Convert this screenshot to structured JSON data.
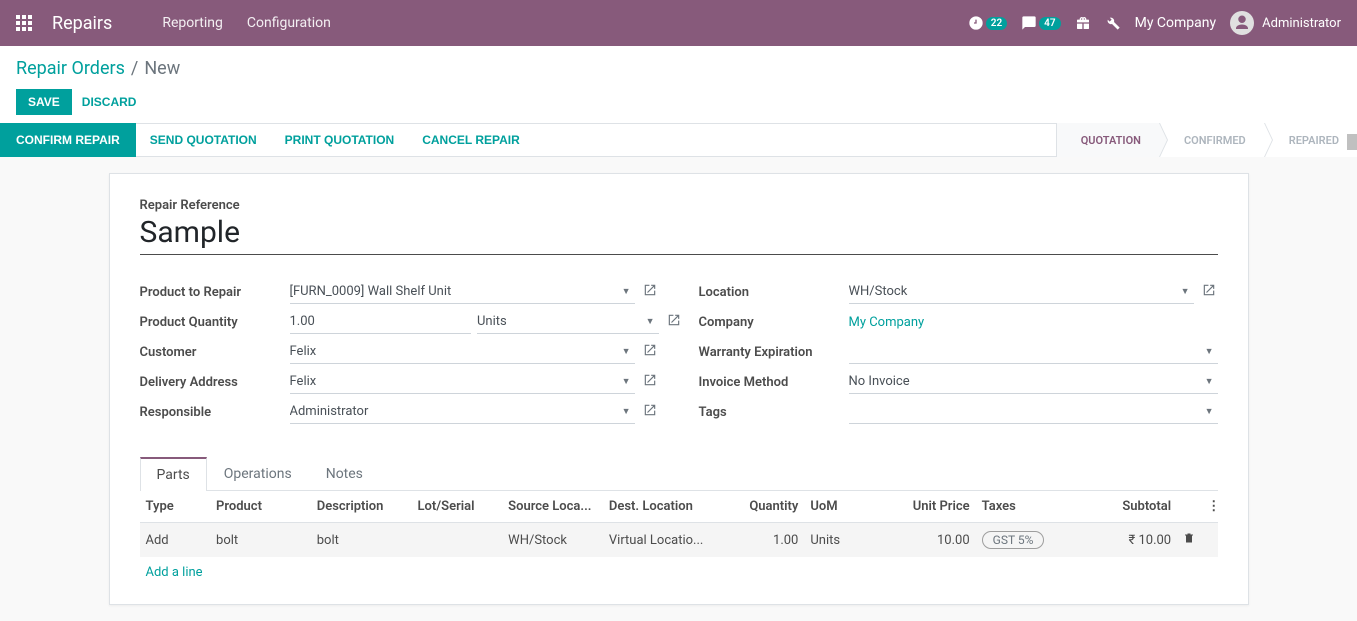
{
  "topbar": {
    "app_name": "Repairs",
    "menu": [
      "Reporting",
      "Configuration"
    ],
    "activity_count": "22",
    "chat_count": "47",
    "company": "My Company",
    "user": "Administrator"
  },
  "breadcrumb": {
    "root": "Repair Orders",
    "current": "New",
    "save": "Save",
    "discard": "Discard"
  },
  "actions": {
    "confirm": "Confirm Repair",
    "send_quote": "Send Quotation",
    "print_quote": "Print Quotation",
    "cancel": "Cancel Repair"
  },
  "status": {
    "quotation": "Quotation",
    "confirmed": "Confirmed",
    "repaired": "Repaired"
  },
  "form": {
    "ref_label": "Repair Reference",
    "ref_value": "Sample",
    "left": {
      "product_label": "Product to Repair",
      "product_value": "[FURN_0009] Wall Shelf Unit",
      "qty_label": "Product Quantity",
      "qty_value": "1.00",
      "qty_uom": "Units",
      "customer_label": "Customer",
      "customer_value": "Felix",
      "delivery_label": "Delivery Address",
      "delivery_value": "Felix",
      "responsible_label": "Responsible",
      "responsible_value": "Administrator"
    },
    "right": {
      "location_label": "Location",
      "location_value": "WH/Stock",
      "company_label": "Company",
      "company_value": "My Company",
      "warranty_label": "Warranty Expiration",
      "warranty_value": "",
      "invoice_label": "Invoice Method",
      "invoice_value": "No Invoice",
      "tags_label": "Tags",
      "tags_value": ""
    }
  },
  "tabs": {
    "parts": "Parts",
    "operations": "Operations",
    "notes": "Notes"
  },
  "table": {
    "headers": {
      "type": "Type",
      "product": "Product",
      "description": "Description",
      "lot": "Lot/Serial",
      "src": "Source Loca...",
      "dest": "Dest. Location",
      "qty": "Quantity",
      "uom": "UoM",
      "price": "Unit Price",
      "taxes": "Taxes",
      "subtotal": "Subtotal"
    },
    "row": {
      "type": "Add",
      "product": "bolt",
      "description": "bolt",
      "lot": "",
      "src": "WH/Stock",
      "dest": "Virtual Locatio...",
      "qty": "1.00",
      "uom": "Units",
      "price": "10.00",
      "tax": "GST 5%",
      "subtotal": "₹ 10.00"
    },
    "add_line": "Add a line"
  }
}
